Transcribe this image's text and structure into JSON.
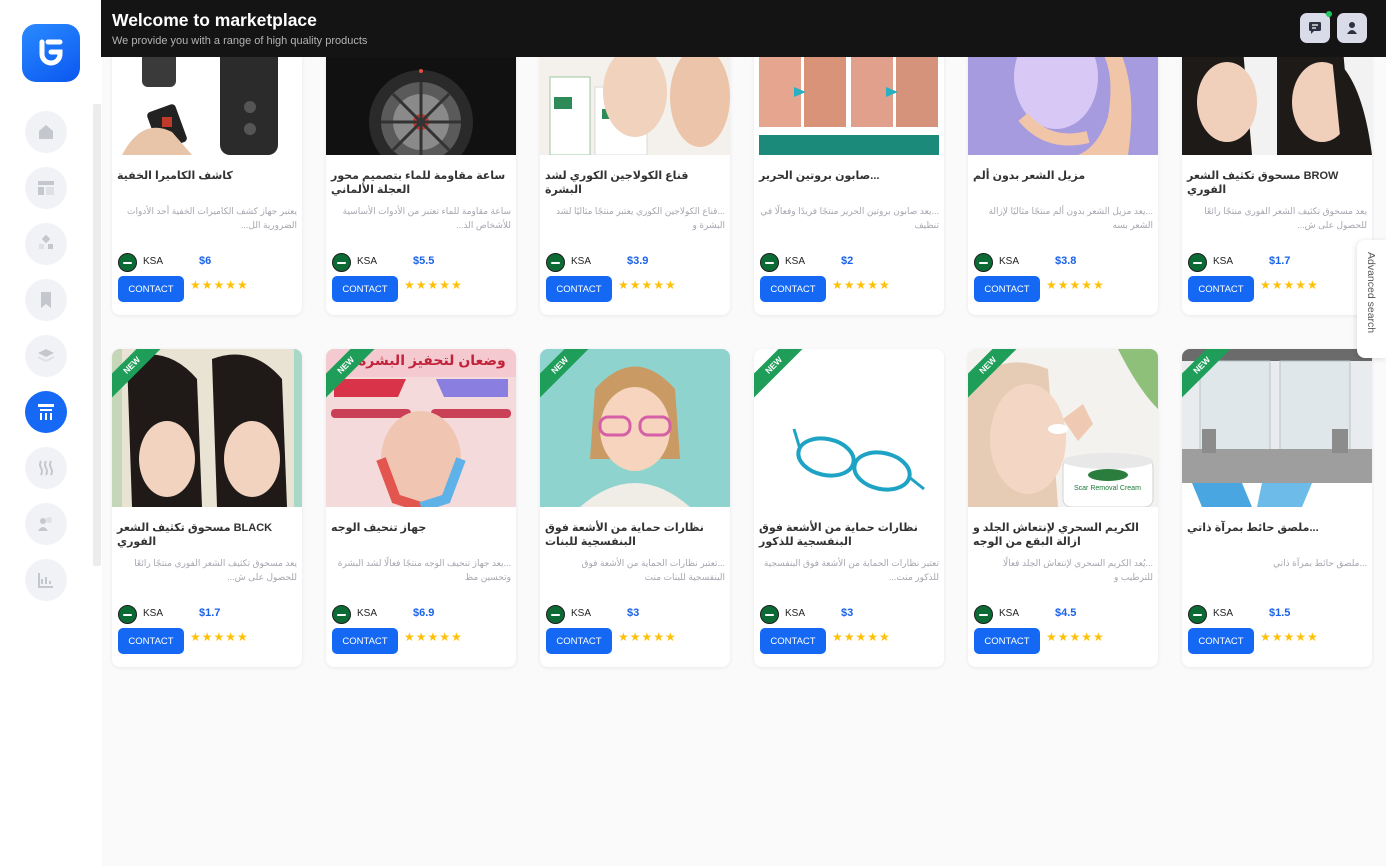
{
  "header": {
    "title": "Welcome to marketplace",
    "subtitle": "We provide you with a range of high quality products"
  },
  "sidebar": {
    "logo": "logo-icon",
    "items": [
      {
        "name": "home",
        "icon": "home-icon",
        "active": false
      },
      {
        "name": "dashboard",
        "icon": "layout-icon",
        "active": false
      },
      {
        "name": "integrations",
        "icon": "apps-icon",
        "active": false
      },
      {
        "name": "bookmarks",
        "icon": "bookmark-icon",
        "active": false
      },
      {
        "name": "layers",
        "icon": "layers-icon",
        "active": false
      },
      {
        "name": "marketplace",
        "icon": "store-icon",
        "active": true
      },
      {
        "name": "waves",
        "icon": "waves-icon",
        "active": false
      },
      {
        "name": "users",
        "icon": "users-icon",
        "active": false
      },
      {
        "name": "analytics",
        "icon": "chart-icon",
        "active": false
      }
    ]
  },
  "advanced_search_label": "Advanced search",
  "product_common": {
    "country": "KSA",
    "contact_label": "CONTACT",
    "stars": "★★★★★",
    "new_label": "NEW",
    "rating": 5
  },
  "products_row1": [
    {
      "title": "كاشف الكاميرا الخفية",
      "desc": "يعتبر جهاز كشف الكاميرات الخفية أحد الأدوات الضرورية الل...",
      "price": "$6"
    },
    {
      "title": "ساعة مقاومة للماء بتصميم محور العجلة الألماني",
      "desc": "ساعة مقاومة للماء تعتبر من الأدوات الأساسية للأشخاص الذ...",
      "price": "$5.5"
    },
    {
      "title": "قناع الكولاجين الكوري لشد البشرة",
      "desc": "...قناع الكولاجين الكوري يعتبر منتجًا مثاليًا لشد البشرة و",
      "price": "$3.9"
    },
    {
      "title": "...صابون بروتين الحرير",
      "desc": "...يعد صابون بروتين الحرير منتجًا فريدًا وفعالًا في تنظيف",
      "price": "$2"
    },
    {
      "title": "مزيل الشعر بدون ألم",
      "desc": "...يعد مزيل الشعر بدون ألم منتجًا مثاليًا لإزالة الشعر بسه",
      "price": "$3.8"
    },
    {
      "title": "BROW مسحوق تكثيف الشعر الفوري",
      "desc": "يعد مسحوق تكثيف الشعر الفوري منتجًا رائعًا للحصول على ش...",
      "price": "$1.7"
    }
  ],
  "products_row2": [
    {
      "title": "BLACK مسحوق تكثيف الشعر الفوري",
      "desc": "يعد مسحوق تكثيف الشعر الفوري منتجًا رائعًا للحصول على ش...",
      "price": "$1.7",
      "is_new": true
    },
    {
      "title": "جهاز تنحيف الوجه",
      "desc": "...يعد جهاز تنحيف الوجه منتجًا فعالًا لشد البشرة وتحسين مظ",
      "price": "$6.9",
      "is_new": true,
      "image_text": "وضعان لتحفيز البشرة"
    },
    {
      "title": "نظارات حماية من الأشعة فوق البنفسجية للبنات",
      "desc": "...تعتبر نظارات الحماية من الأشعة فوق البنفسجية للبنات منت",
      "price": "$3",
      "is_new": true
    },
    {
      "title": "نظارات حماية من الأشعة فوق البنفسجية للذكور",
      "desc": "تعتبر نظارات الحماية من الأشعة فوق البنفسجية للذكور منت...",
      "price": "$3",
      "is_new": true
    },
    {
      "title": "الكريم السحري لإنتعاش الجلد و ازالة البقع من الوجه",
      "desc": "...يُعد الكريم السحري لإنتعاش الجلد فعالًا للترطيب و",
      "price": "$4.5",
      "is_new": true,
      "image_text": "Scar Removal Cream"
    },
    {
      "title": "...ملصق حائط بمرآة ذاتي",
      "desc": "...ملصق حائط بمرآة ذاتي",
      "price": "$1.5",
      "is_new": true
    }
  ]
}
